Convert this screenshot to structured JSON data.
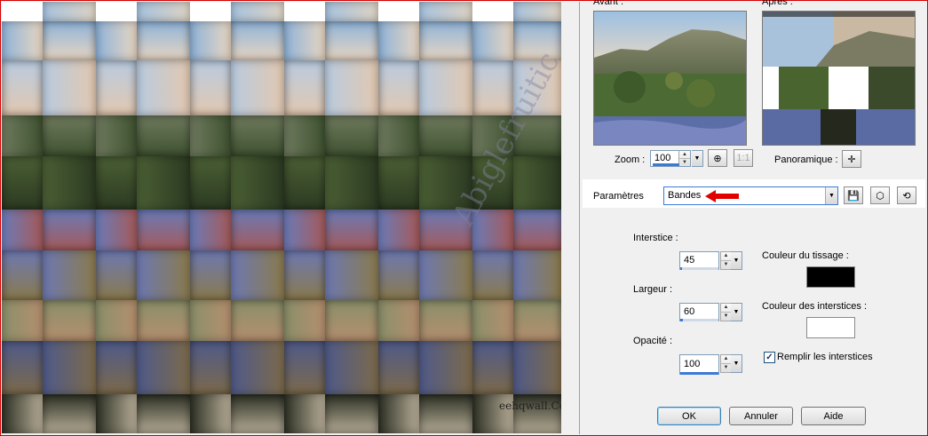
{
  "colors": {
    "frame_border": "#d40000",
    "weave_color": "#000000",
    "interstice_color": "#ffffff",
    "accent_blue": "#3d7ad6",
    "arrow_red": "#e00000"
  },
  "image": {
    "watermark_text": "Abiglefruitic",
    "caption_text": "eehqwall.Co"
  },
  "preview": {
    "before_label": "Avant :",
    "after_label": "Après :"
  },
  "zoom": {
    "label": "Zoom :",
    "value": "100",
    "fit_icon": "zoom-fit-icon",
    "actual_icon": "zoom-actual-icon"
  },
  "pan": {
    "label": "Panoramique :",
    "icon": "move-cross-icon"
  },
  "presets": {
    "label": "Paramètres",
    "value": "Bandes",
    "save_icon": "floppy-disk-icon",
    "cube_icon": "cube-icon",
    "reset_icon": "reset-icon"
  },
  "settings": {
    "gap_label": "Interstice :",
    "gap_value": "45",
    "gap_level": 45,
    "width_label": "Largeur :",
    "width_value": "60",
    "width_level": 60,
    "opacity_label": "Opacité :",
    "opacity_value": "100",
    "opacity_level": 100,
    "weave_color_label": "Couleur du tissage :",
    "gap_color_label": "Couleur des interstices :",
    "fill_label": "Remplir les interstices",
    "fill_checked": true
  },
  "buttons": {
    "ok": "OK",
    "cancel": "Annuler",
    "help": "Aide"
  }
}
